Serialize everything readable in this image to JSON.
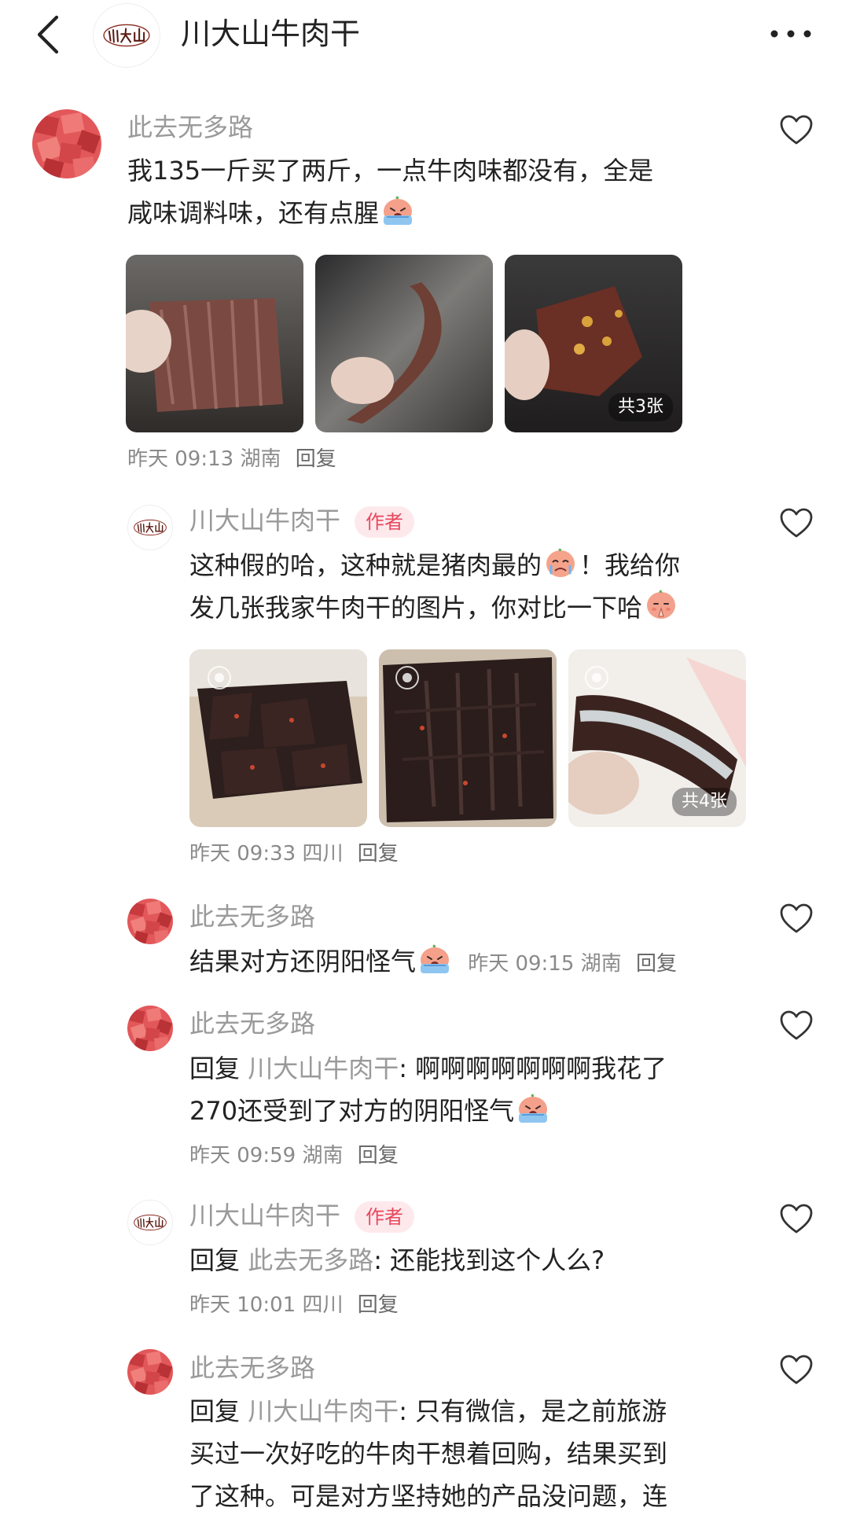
{
  "header": {
    "title": "川大山牛肉干",
    "logo_text": "川大山"
  },
  "comments": [
    {
      "user": "此去无多路",
      "text": "我135一斤买了两斤，一点牛肉味都没有，全是咸味调料味，还有点腥",
      "line1": "我135一斤买了两斤，一点牛肉味都没有，全是",
      "line2": "咸味调料味，还有点腥",
      "photo_count": "共3张",
      "time": "昨天 09:13",
      "location": "湖南",
      "reply_label": "回复"
    },
    {
      "user": "川大山牛肉干",
      "badge": "作者",
      "line1a": "这种假的哈，这种就是猪肉最的",
      "line1b": "！我给你",
      "line2": "发几张我家牛肉干的图片，你对比一下哈",
      "photo_count": "共4张",
      "time": "昨天 09:33",
      "location": "四川",
      "reply_label": "回复"
    },
    {
      "user": "此去无多路",
      "text": "结果对方还阴阳怪气",
      "time": "昨天 09:15",
      "location": "湖南",
      "reply_label": "回复"
    },
    {
      "user": "此去无多路",
      "reply_prefix": "回复",
      "reply_target": "川大山牛肉干",
      "line1": ": 啊啊啊啊啊啊啊我花了",
      "line2": "270还受到了对方的阴阳怪气",
      "time": "昨天 09:59",
      "location": "湖南",
      "reply_label": "回复"
    },
    {
      "user": "川大山牛肉干",
      "badge": "作者",
      "reply_prefix": "回复",
      "reply_target": "此去无多路",
      "line1": ": 还能找到这个人么?",
      "time": "昨天 10:01",
      "location": "四川",
      "reply_label": "回复"
    },
    {
      "user": "此去无多路",
      "reply_prefix": "回复",
      "reply_target": "川大山牛肉干",
      "line1": ": 只有微信，是之前旅游",
      "line2": "买过一次好吃的牛肉干想着回购，结果买到",
      "line3": "了这种。可是对方坚持她的产品没问题，连"
    }
  ],
  "icons": {
    "back": "chevron-left-icon",
    "more": "more-dots-icon",
    "like": "heart-outline-icon"
  },
  "colors": {
    "username": "#9a9a9a",
    "badge_bg": "#fde9ec",
    "badge_text": "#e8485e"
  }
}
